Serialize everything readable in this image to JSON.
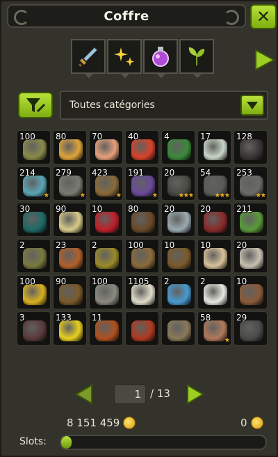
{
  "window": {
    "title": "Coffre",
    "close_label": "✕"
  },
  "tabs": [
    {
      "icon": "sword-icon"
    },
    {
      "icon": "sparkles-icon"
    },
    {
      "icon": "potion-icon"
    },
    {
      "icon": "leaf-icon"
    }
  ],
  "filter": {
    "icon": "filter-tools-icon",
    "selected": "Toutes catégories"
  },
  "items": [
    {
      "qty": "100",
      "color": "#8a8a4a",
      "stars": ""
    },
    {
      "qty": "80",
      "color": "#e0a43a",
      "stars": ""
    },
    {
      "qty": "70",
      "color": "#e6a07a",
      "stars": ""
    },
    {
      "qty": "40",
      "color": "#d8422a",
      "stars": ""
    },
    {
      "qty": "4",
      "color": "#3a8a3a",
      "stars": ""
    },
    {
      "qty": "17",
      "color": "#c9d6c8",
      "stars": ""
    },
    {
      "qty": "128",
      "color": "#3a3535",
      "stars": ""
    },
    {
      "qty": "214",
      "color": "#5aa6b6",
      "stars": "★"
    },
    {
      "qty": "279",
      "color": "#7a7a70",
      "stars": "★"
    },
    {
      "qty": "423",
      "color": "#8a6a3a",
      "stars": "★"
    },
    {
      "qty": "191",
      "color": "#6a4a9a",
      "stars": "★"
    },
    {
      "qty": "20",
      "color": "#4a4a44",
      "stars": "★★★"
    },
    {
      "qty": "54",
      "color": "#5a5a56",
      "stars": "★★★"
    },
    {
      "qty": "253",
      "color": "#6a6a66",
      "stars": "★★"
    },
    {
      "qty": "30",
      "color": "#1f6a66",
      "stars": ""
    },
    {
      "qty": "90",
      "color": "#d8ca8a",
      "stars": ""
    },
    {
      "qty": "10",
      "color": "#c01f2a",
      "stars": ""
    },
    {
      "qty": "80",
      "color": "#6a4a2a",
      "stars": ""
    },
    {
      "qty": "20",
      "color": "#9aaab0",
      "stars": ""
    },
    {
      "qty": "20",
      "color": "#8a2a2a",
      "stars": ""
    },
    {
      "qty": "211",
      "color": "#5a9a3a",
      "stars": ""
    },
    {
      "qty": "2",
      "color": "#7a7a40",
      "stars": ""
    },
    {
      "qty": "23",
      "color": "#b0602a",
      "stars": ""
    },
    {
      "qty": "2",
      "color": "#9a8a2a",
      "stars": ""
    },
    {
      "qty": "100",
      "color": "#8a6a3a",
      "stars": ""
    },
    {
      "qty": "10",
      "color": "#7a5a2a",
      "stars": ""
    },
    {
      "qty": "10",
      "color": "#d8c09a",
      "stars": ""
    },
    {
      "qty": "20",
      "color": "#c8c0b0",
      "stars": ""
    },
    {
      "qty": "100",
      "color": "#d8b020",
      "stars": ""
    },
    {
      "qty": "90",
      "color": "#7a5a2a",
      "stars": ""
    },
    {
      "qty": "100",
      "color": "#8a8a80",
      "stars": ""
    },
    {
      "qty": "1105",
      "color": "#e0dcc8",
      "stars": ""
    },
    {
      "qty": "2",
      "color": "#4a9ad0",
      "stars": ""
    },
    {
      "qty": "2",
      "color": "#e8e8e0",
      "stars": ""
    },
    {
      "qty": "10",
      "color": "#8a5a3a",
      "stars": ""
    },
    {
      "qty": "3",
      "color": "#5a3a3a",
      "stars": ""
    },
    {
      "qty": "133",
      "color": "#e8d020",
      "stars": ""
    },
    {
      "qty": "11",
      "color": "#b05020",
      "stars": ""
    },
    {
      "qty": "",
      "color": "#b03a20",
      "stars": ""
    },
    {
      "qty": "",
      "color": "#8a7a5a",
      "stars": ""
    },
    {
      "qty": "58",
      "color": "#b07a5a",
      "stars": "★"
    },
    {
      "qty": "29",
      "color": "#4a4a48",
      "stars": ""
    }
  ],
  "pagination": {
    "current": "1",
    "of": "/ 13"
  },
  "kamas": {
    "inventory": "8 151 459",
    "other": "0"
  },
  "slots": {
    "label": "Slots:",
    "fill_fraction": 0.05
  },
  "colors": {
    "accent": "#9ccf22",
    "gold": "#f3b21b"
  }
}
